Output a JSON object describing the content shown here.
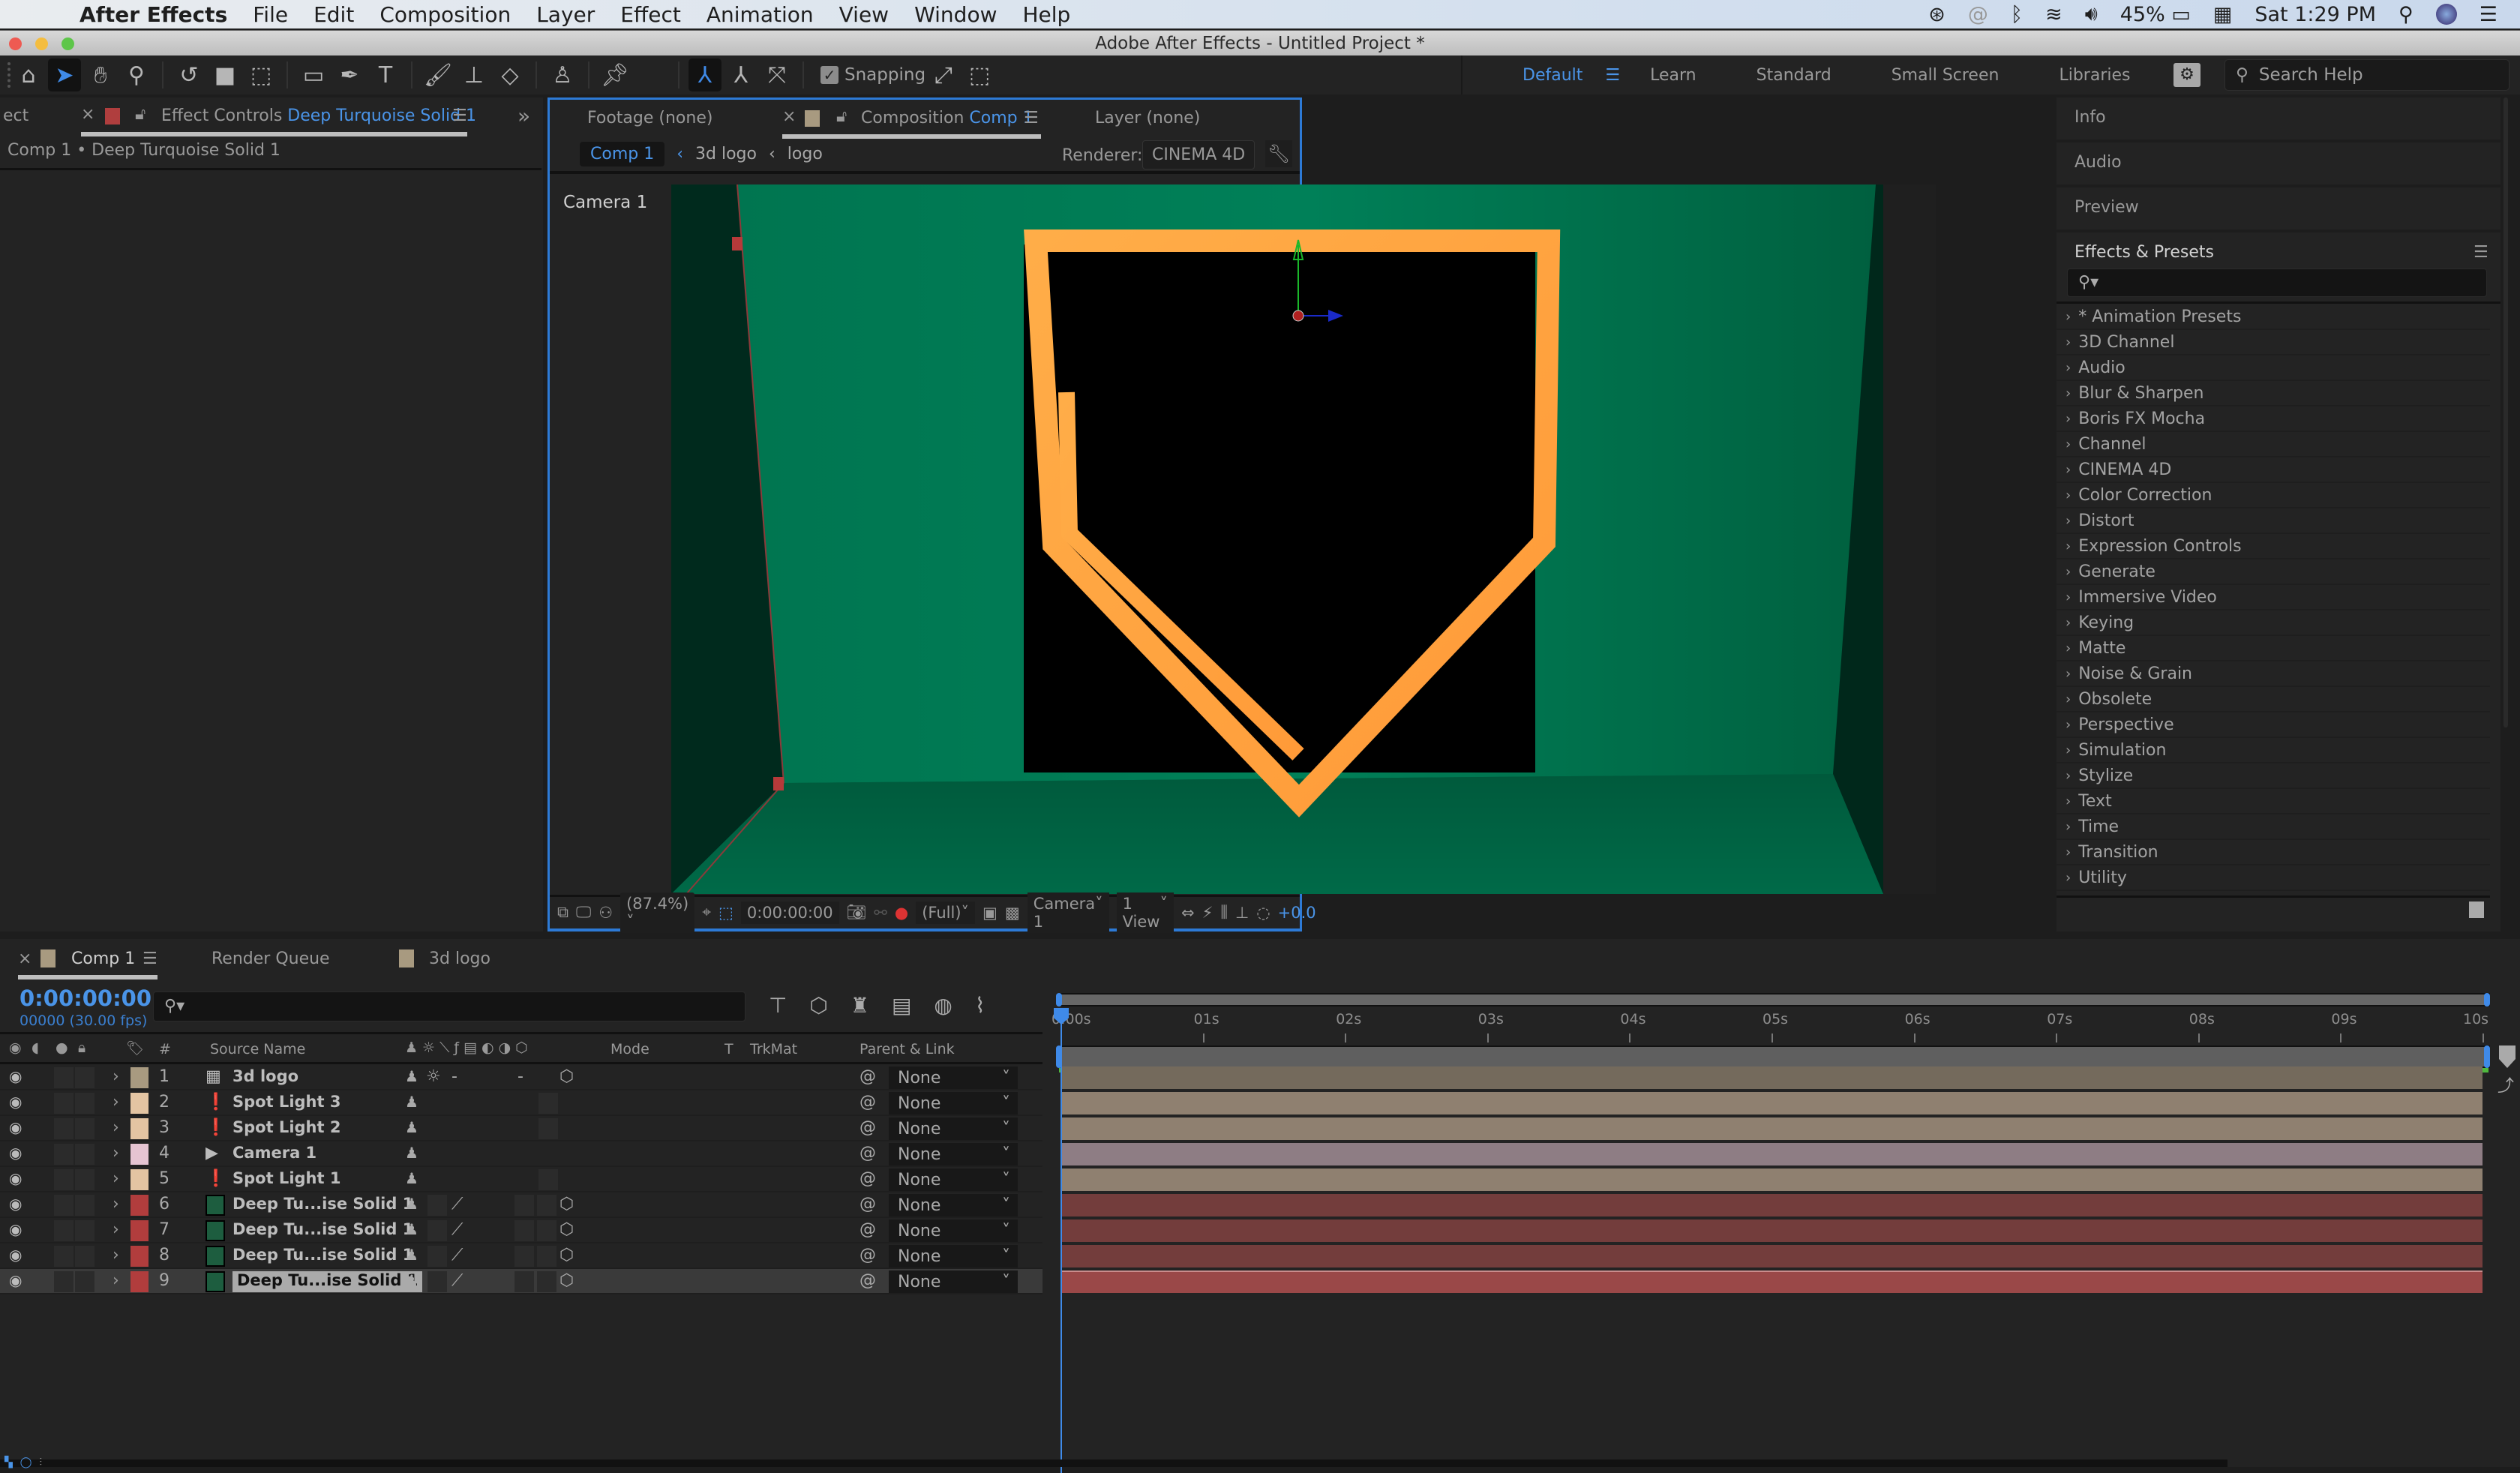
{
  "menubar": {
    "app_name": "After Effects",
    "items": [
      "File",
      "Edit",
      "Composition",
      "Layer",
      "Effect",
      "Animation",
      "View",
      "Window",
      "Help"
    ],
    "battery": "45%",
    "clock": "Sat 1:29 PM"
  },
  "window": {
    "title": "Adobe After Effects - Untitled Project *"
  },
  "toolbar": {
    "snapping_label": "Snapping",
    "snapping_checked": true,
    "workspaces": [
      "Default",
      "Learn",
      "Standard",
      "Small Screen",
      "Libraries"
    ],
    "active_workspace": "Default",
    "search_placeholder": "Search Help"
  },
  "left_panel": {
    "clipped_tab": "ect",
    "tab_prefix": "Effect Controls",
    "tab_layer": "Deep Turquoise Solid 1",
    "subtitle": "Comp 1 • Deep Turquoise Solid 1"
  },
  "viewer": {
    "tabs": {
      "footage": "Footage (none)",
      "composition_prefix": "Composition",
      "composition_name": "Comp 1",
      "layer": "Layer (none)"
    },
    "breadcrumbs": [
      "Comp 1",
      "3d logo",
      "logo"
    ],
    "renderer_label": "Renderer:",
    "renderer_value": "CINEMA 4D",
    "camera_label": "Camera 1",
    "footer": {
      "zoom": "(87.4%)",
      "timecode": "0:00:00:00",
      "resolution": "(Full)",
      "camera": "Camera 1",
      "views": "1 View",
      "exposure": "+0.0"
    },
    "colors": {
      "wall": "#007a55",
      "logo": "#ffa640",
      "logo_bg": "#000000"
    }
  },
  "right_panel": {
    "sections": [
      "Info",
      "Audio",
      "Preview"
    ],
    "effects_title": "Effects & Presets",
    "effects_search_placeholder": "",
    "effects": [
      "* Animation Presets",
      "3D Channel",
      "Audio",
      "Blur & Sharpen",
      "Boris FX Mocha",
      "Channel",
      "CINEMA 4D",
      "Color Correction",
      "Distort",
      "Expression Controls",
      "Generate",
      "Immersive Video",
      "Keying",
      "Matte",
      "Noise & Grain",
      "Obsolete",
      "Perspective",
      "Simulation",
      "Stylize",
      "Text",
      "Time",
      "Transition",
      "Utility"
    ]
  },
  "timeline": {
    "tabs": [
      {
        "label": "Comp 1",
        "active": true
      },
      {
        "label": "Render Queue",
        "active": false
      },
      {
        "label": "3d logo",
        "active": false
      }
    ],
    "timecode": "0:00:00:00",
    "frame_info": "00000 (30.00 fps)",
    "search_placeholder": "",
    "columns": {
      "num": "#",
      "source_name": "Source Name",
      "mode": "Mode",
      "t": "T",
      "trkmat": "TrkMat",
      "parent": "Parent & Link"
    },
    "ruler": [
      "0:00s",
      "01s",
      "02s",
      "03s",
      "04s",
      "05s",
      "06s",
      "07s",
      "08s",
      "09s",
      "10s"
    ],
    "current_time_s": 0,
    "duration_s": 10,
    "layers": [
      {
        "num": "1",
        "name": "3d logo",
        "label_color": "#a89a80",
        "type": "precomp",
        "parent": "None",
        "bar_color": "#746a5c"
      },
      {
        "num": "2",
        "name": "Spot Light 3",
        "label_color": "#e3c4a2",
        "type": "light",
        "parent": "None",
        "bar_color": "#8f8070"
      },
      {
        "num": "3",
        "name": "Spot Light 2",
        "label_color": "#e3c4a2",
        "type": "light",
        "parent": "None",
        "bar_color": "#8f8070"
      },
      {
        "num": "4",
        "name": "Camera 1",
        "label_color": "#e5c4d2",
        "type": "camera",
        "parent": "None",
        "bar_color": "#8e7d84"
      },
      {
        "num": "5",
        "name": "Spot Light 1",
        "label_color": "#e3c4a2",
        "type": "light",
        "parent": "None",
        "bar_color": "#8f8070"
      },
      {
        "num": "6",
        "name": "Deep Tu...ise Solid 1",
        "label_color": "#b13d3d",
        "type": "solid",
        "parent": "None",
        "bar_color": "#733d3c"
      },
      {
        "num": "7",
        "name": "Deep Tu...ise Solid 1",
        "label_color": "#b13d3d",
        "type": "solid",
        "parent": "None",
        "bar_color": "#733d3c"
      },
      {
        "num": "8",
        "name": "Deep Tu...ise Solid 1",
        "label_color": "#b13d3d",
        "type": "solid",
        "parent": "None",
        "bar_color": "#733d3c"
      },
      {
        "num": "9",
        "name": "Deep Tu...ise Solid 1",
        "label_color": "#b13d3d",
        "type": "solid",
        "parent": "None",
        "bar_color": "#9a4848",
        "selected": true
      }
    ]
  }
}
